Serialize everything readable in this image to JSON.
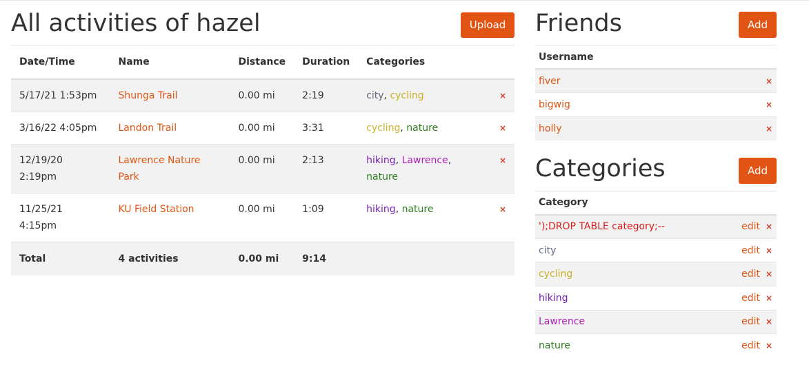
{
  "activities": {
    "title": "All activities of hazel",
    "upload_label": "Upload",
    "columns": [
      "Date/Time",
      "Name",
      "Distance",
      "Duration",
      "Categories"
    ],
    "rows": [
      {
        "date": "5/17/21 1:53pm",
        "name": "Shunga Trail",
        "distance": "0.00 mi",
        "duration": "2:19",
        "categories": [
          {
            "label": "city",
            "color": "#666a80"
          },
          {
            "label": "cycling",
            "color": "#c9b125"
          }
        ]
      },
      {
        "date": "3/16/22 4:05pm",
        "name": "Landon Trail",
        "distance": "0.00 mi",
        "duration": "3:31",
        "categories": [
          {
            "label": "cycling",
            "color": "#c9b125"
          },
          {
            "label": "nature",
            "color": "#2e7d1f"
          }
        ]
      },
      {
        "date": "12/19/20 2:19pm",
        "name": "Lawrence Nature Park",
        "distance": "0.00 mi",
        "duration": "2:13",
        "categories": [
          {
            "label": "hiking",
            "color": "#7a1fb3"
          },
          {
            "label": "Lawrence",
            "color": "#b01fb8"
          },
          {
            "label": "nature",
            "color": "#2e7d1f"
          }
        ]
      },
      {
        "date": "11/25/21 4:15pm",
        "name": "KU Field Station",
        "distance": "0.00 mi",
        "duration": "1:09",
        "categories": [
          {
            "label": "hiking",
            "color": "#7a1fb3"
          },
          {
            "label": "nature",
            "color": "#2e7d1f"
          }
        ]
      }
    ],
    "footer": {
      "label": "Total",
      "count": "4 activities",
      "distance": "0.00 mi",
      "duration": "9:14"
    },
    "delete_glyph": "×"
  },
  "friends": {
    "title": "Friends",
    "add_label": "Add",
    "column": "Username",
    "items": [
      "fiver",
      "bigwig",
      "holly"
    ]
  },
  "categories": {
    "title": "Categories",
    "add_label": "Add",
    "column": "Category",
    "edit_label": "edit",
    "items": [
      {
        "label": "');DROP TABLE category;--",
        "color": "#d91c1c"
      },
      {
        "label": "city",
        "color": "#666a80"
      },
      {
        "label": "cycling",
        "color": "#c9b125"
      },
      {
        "label": "hiking",
        "color": "#7a1fb3"
      },
      {
        "label": "Lawrence",
        "color": "#b01fb8"
      },
      {
        "label": "nature",
        "color": "#2e7d1f"
      }
    ]
  },
  "colors": {
    "accent": "#e25413",
    "delete": "#d23c28",
    "row_shade": "#f2f2f2"
  }
}
